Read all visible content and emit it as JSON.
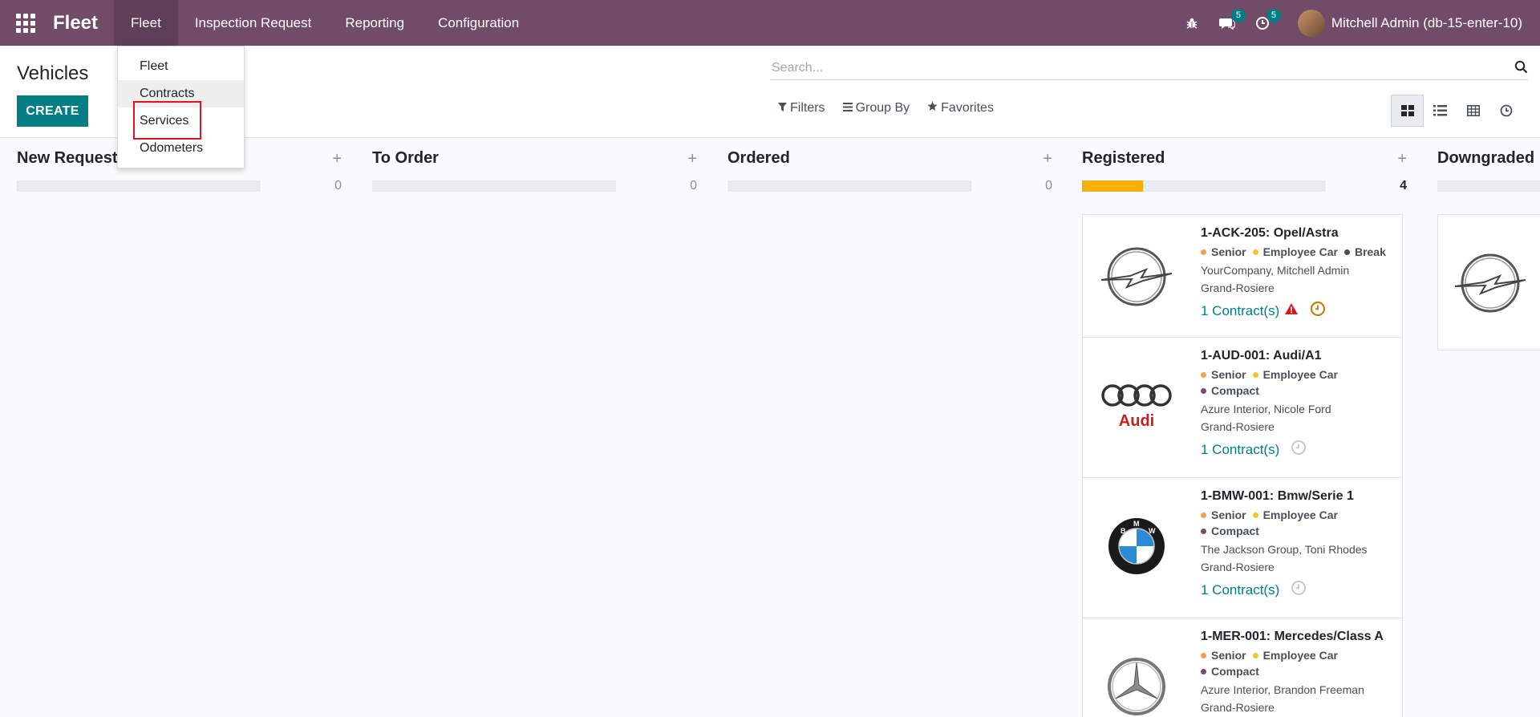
{
  "navbar": {
    "brand": "Fleet",
    "menus": [
      "Fleet",
      "Inspection Request",
      "Reporting",
      "Configuration"
    ],
    "messages_count": "5",
    "activities_count": "5",
    "user_name": "Mitchell Admin (db-15-enter-10)"
  },
  "fleet_dropdown": {
    "items": [
      "Fleet",
      "Contracts",
      "Services",
      "Odometers"
    ]
  },
  "control_panel": {
    "title": "Vehicles",
    "create_label": "CREATE",
    "search_placeholder": "Search...",
    "filters_label": "Filters",
    "group_by_label": "Group By",
    "favorites_label": "Favorites"
  },
  "kanban": {
    "columns": [
      {
        "title": "New Request",
        "count": "0",
        "progress": 0
      },
      {
        "title": "To Order",
        "count": "0",
        "progress": 0
      },
      {
        "title": "Ordered",
        "count": "0",
        "progress": 0
      },
      {
        "title": "Registered",
        "count": "4",
        "progress": 0.25
      },
      {
        "title": "Downgraded",
        "count": "",
        "progress": 0
      }
    ],
    "cards": [
      {
        "name": "1-ACK-205: Opel/Astra",
        "logo": "opel-logo",
        "tags": [
          {
            "label": "Senior",
            "color": "#f0a050"
          },
          {
            "label": "Employee Car",
            "color": "#f4c430"
          },
          {
            "label": "Break",
            "color": "#454d66"
          }
        ],
        "company": "YourCompany, Mitchell Admin",
        "location": "Grand-Rosiere",
        "contracts": "1 Contract(s)",
        "warning": true,
        "activity_color": "#b8860b"
      },
      {
        "name": "1-AUD-001: Audi/A1",
        "logo": "audi-logo",
        "tags": [
          {
            "label": "Senior",
            "color": "#f0a050"
          },
          {
            "label": "Employee Car",
            "color": "#f4c430"
          },
          {
            "label": "Compact",
            "color": "#7a4a6d"
          }
        ],
        "company": "Azure Interior, Nicole Ford",
        "location": "Grand-Rosiere",
        "contracts": "1 Contract(s)",
        "warning": false,
        "activity_color": "#c8c8c8"
      },
      {
        "name": "1-BMW-001: Bmw/Serie 1",
        "logo": "bmw-logo",
        "tags": [
          {
            "label": "Senior",
            "color": "#f0a050"
          },
          {
            "label": "Employee Car",
            "color": "#f4c430"
          },
          {
            "label": "Compact",
            "color": "#7a4a6d"
          }
        ],
        "company": "The Jackson Group, Toni Rhodes",
        "location": "Grand-Rosiere",
        "contracts": "1 Contract(s)",
        "warning": false,
        "activity_color": "#c8c8c8"
      },
      {
        "name": "1-MER-001: Mercedes/Class A",
        "logo": "mercedes-logo",
        "tags": [
          {
            "label": "Senior",
            "color": "#f0a050"
          },
          {
            "label": "Employee Car",
            "color": "#f4c430"
          },
          {
            "label": "Compact",
            "color": "#7a4a6d"
          }
        ],
        "company": "Azure Interior, Brandon Freeman",
        "location": "Grand-Rosiere",
        "contracts": "",
        "warning": false,
        "activity_color": ""
      }
    ],
    "downgraded_card_logo": "opel-logo"
  },
  "colors": {
    "navbar": "#714b67",
    "primary": "#017e84",
    "progress_fill": "#f7b000",
    "highlight": "#e0141e"
  }
}
